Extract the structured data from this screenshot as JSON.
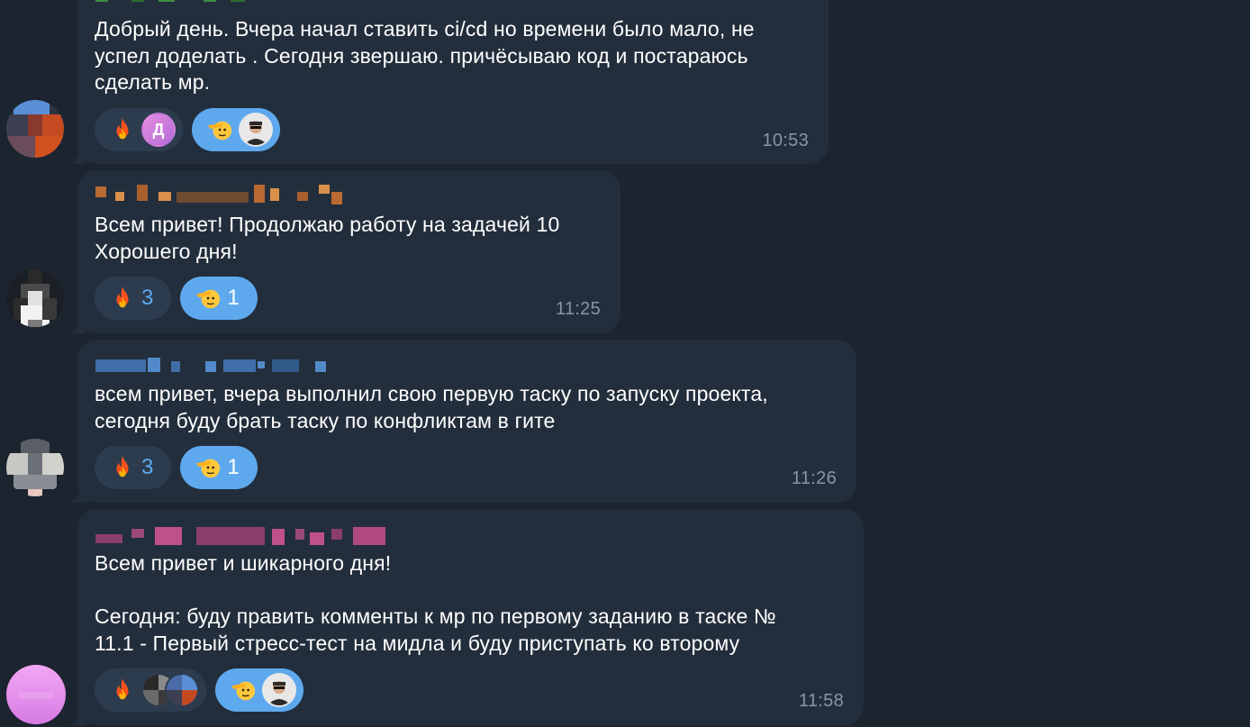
{
  "messages": [
    {
      "sender": "",
      "text": "Добрый день. Вчера начал ставить ci/cd но времени было мало, не\nуспел доделать . Сегодня звершаю. причёсываю код и постараюсь\nсделать мр.",
      "time": "10:53",
      "reactions": [
        {
          "emoji": "fire-icon",
          "count": "",
          "avatars": [
            "Д"
          ]
        },
        {
          "emoji": "salute-icon",
          "count": "",
          "avatars": [
            ""
          ]
        }
      ]
    },
    {
      "sender": "",
      "text": "Всем привет! Продолжаю работу на задачей 10\nХорошего дня!",
      "time": "11:25",
      "reactions": [
        {
          "emoji": "fire-icon",
          "count": "3"
        },
        {
          "emoji": "salute-icon",
          "count": "1"
        }
      ]
    },
    {
      "sender": "",
      "text": "всем привет, вчера выполнил свою первую таску по запуску проекта,\nсегодня буду брать таску по конфликтам в гите",
      "time": "11:26",
      "reactions": [
        {
          "emoji": "fire-icon",
          "count": "3"
        },
        {
          "emoji": "salute-icon",
          "count": "1"
        }
      ]
    },
    {
      "sender": "",
      "text": "Всем привет и шикарного дня!\n\nСегодня: буду править комменты к мр по первому заданию в таске №\n11.1 - Первый стресс-тест на мидла и буду приступать ко второму",
      "time": "11:58",
      "reactions": [
        {
          "emoji": "fire-icon",
          "count": "",
          "avatars": [
            "",
            ""
          ]
        },
        {
          "emoji": "salute-icon",
          "count": "",
          "avatars": [
            ""
          ]
        }
      ]
    }
  ],
  "colors": {
    "background": "#1c242f",
    "bubble": "#232e3c",
    "reaction": "#2c3c4e",
    "reaction_mine": "#5ea9ee",
    "time": "#8596a7",
    "sender_orange": "#d9904a",
    "sender_blue": "#5289c9",
    "sender_pink": "#c0508a"
  }
}
